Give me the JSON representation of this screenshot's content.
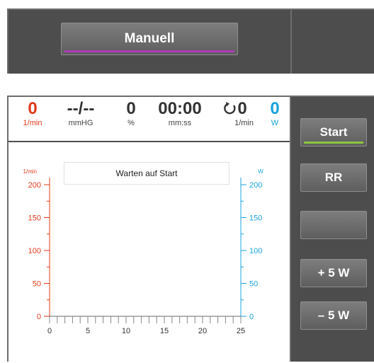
{
  "mode": {
    "label": "Manuell"
  },
  "readouts": [
    {
      "value": "0",
      "unit": "1/min",
      "color": "#e03a1a"
    },
    {
      "value": "--/--",
      "unit": "mmHG",
      "color": "#333333"
    },
    {
      "value": "0",
      "unit": "%",
      "color": "#333333"
    },
    {
      "value": "00:00",
      "unit": "mm:ss",
      "color": "#333333"
    },
    {
      "value": "0",
      "unit": "1/min",
      "color": "#333333",
      "icon": "cycle-icon"
    },
    {
      "value": "0",
      "unit": "W",
      "color": "#1aa3dc"
    }
  ],
  "status": "Warten auf Start",
  "buttons": {
    "start": "Start",
    "rr": "RR",
    "blank": "",
    "plus5w": "+ 5 W",
    "minus5w": "– 5 W"
  },
  "colors": {
    "pulse_axis": "#e03a1a",
    "power_axis": "#1aa3dc",
    "accent_start": "#8cc63f",
    "accent_mode": "#b03ab8"
  },
  "chart_data": {
    "type": "line",
    "series": [],
    "x_ticks": [
      "0",
      "5",
      "10",
      "15",
      "20",
      "25"
    ],
    "xlim": [
      0,
      25
    ],
    "left_axis": {
      "label": "1/min",
      "ticks": [
        "0",
        "50",
        "100",
        "150",
        "200"
      ],
      "ylim": [
        0,
        200
      ]
    },
    "right_axis": {
      "label": "W",
      "ticks": [
        "0",
        "50",
        "100",
        "150",
        "200"
      ],
      "ylim": [
        0,
        200
      ]
    }
  }
}
